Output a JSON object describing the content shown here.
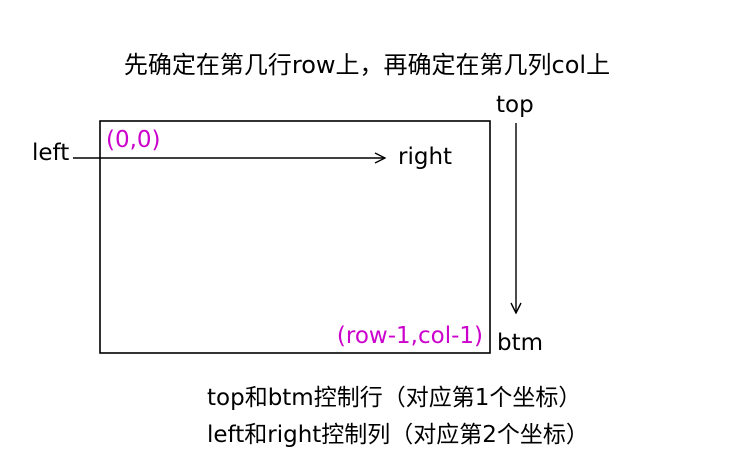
{
  "title": "先确定在第几行row上，再确定在第几列col上",
  "labels": {
    "left": "left",
    "right": "right",
    "top": "top",
    "btm": "btm",
    "origin": "(0,0)",
    "corner": "(row-1,col-1)"
  },
  "notes": {
    "line1": "top和btm控制行（对应第1个坐标）",
    "line2": "left和right控制列（对应第2个坐标）"
  },
  "colors": {
    "accent": "#cc00cc",
    "stroke": "#000000"
  }
}
